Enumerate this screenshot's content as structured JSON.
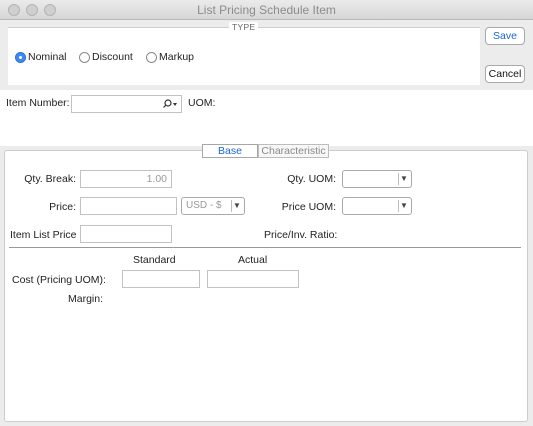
{
  "window": {
    "title": "List Pricing Schedule Item"
  },
  "type_group": {
    "title": "TYPE",
    "options": [
      {
        "label": "Nominal",
        "selected": true
      },
      {
        "label": "Discount",
        "selected": false
      },
      {
        "label": "Markup",
        "selected": false
      }
    ]
  },
  "buttons": {
    "save": "Save",
    "cancel": "Cancel"
  },
  "item": {
    "label": "Item Number:",
    "value": "",
    "uom_label": "UOM:",
    "uom_value": ""
  },
  "tabs": [
    {
      "label": "Base",
      "active": true
    },
    {
      "label": "Characteristic",
      "active": false
    }
  ],
  "base": {
    "qty_break_label": "Qty. Break:",
    "qty_break_value": "1.00",
    "qty_uom_label": "Qty. UOM:",
    "qty_uom_value": "",
    "price_label": "Price:",
    "price_value": "",
    "currency_value": "USD - $",
    "price_uom_label": "Price UOM:",
    "price_uom_value": "",
    "item_list_price_label": "Item List Price",
    "item_list_price_value": "",
    "price_ratio_label": "Price/Inv. Ratio:",
    "price_ratio_value": "",
    "standard_header": "Standard",
    "actual_header": "Actual",
    "cost_label": "Cost (Pricing UOM):",
    "cost_standard_value": "",
    "cost_actual_value": "",
    "margin_label": "Margin:",
    "margin_value": ""
  },
  "colors": {
    "accent": "#3d8bf0",
    "link": "#1a64d8",
    "window_bg": "#ececec"
  }
}
